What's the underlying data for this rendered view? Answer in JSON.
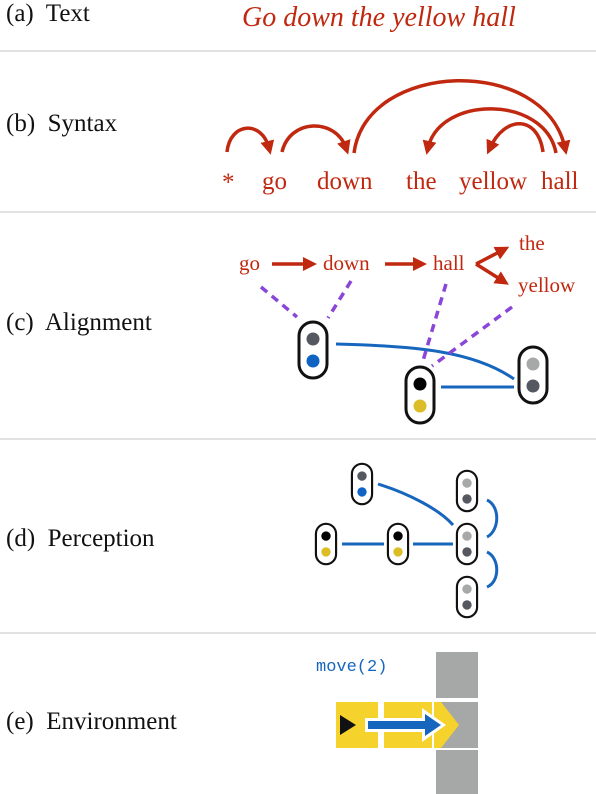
{
  "panels": [
    {
      "id": "a",
      "label": "(a)  Text"
    },
    {
      "id": "b",
      "label": "(b)  Syntax"
    },
    {
      "id": "c",
      "label": "(c)  Alignment"
    },
    {
      "id": "d",
      "label": "(d)  Perception"
    },
    {
      "id": "e",
      "label": "(e)  Environment"
    }
  ],
  "text_panel": {
    "sentence": "Go down the yellow hall"
  },
  "syntax_panel": {
    "tokens": [
      "*",
      "go",
      "down",
      "the",
      "yellow",
      "hall"
    ],
    "arcs": [
      {
        "from": "*",
        "to": "go"
      },
      {
        "from": "go",
        "to": "down"
      },
      {
        "from": "down",
        "to": "hall"
      },
      {
        "from": "hall",
        "to": "the"
      },
      {
        "from": "hall",
        "to": "yellow"
      }
    ]
  },
  "alignment_panel": {
    "words": [
      "go",
      "down",
      "hall",
      "the",
      "yellow"
    ],
    "chain": [
      {
        "from": "go",
        "to": "down"
      },
      {
        "from": "down",
        "to": "hall"
      },
      {
        "from": "hall",
        "to": "the"
      },
      {
        "from": "hall",
        "to": "yellow"
      }
    ]
  },
  "environment_panel": {
    "action": "move(2)"
  },
  "colors": {
    "text_red": "#c0280f",
    "align_purple": "#8a46d8",
    "edge_blue": "#1766be",
    "node_dark_gray": "#555860",
    "node_light_gray": "#a7a9a9",
    "node_blue": "#0f64c3",
    "node_yellow": "#dcbd27",
    "env_yellow": "#f5d22c",
    "env_gray": "#a6a8a7",
    "divider": "#e2e2e2"
  }
}
